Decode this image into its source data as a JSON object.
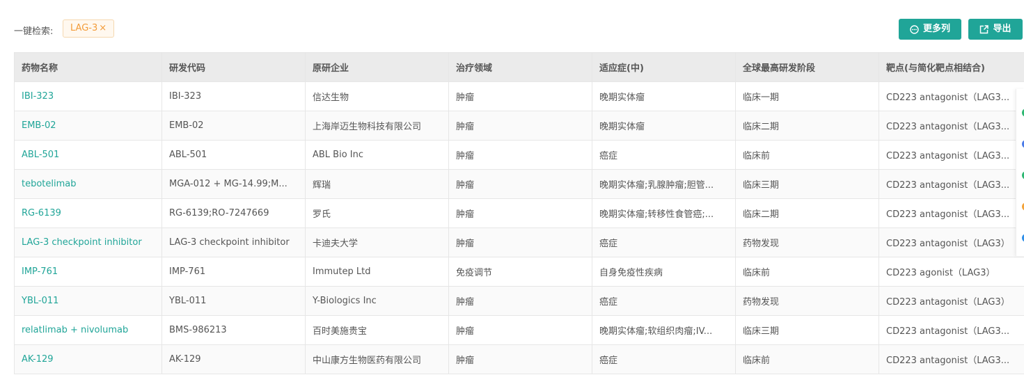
{
  "search": {
    "label": "一键检索:",
    "tag": "LAG-3",
    "tag_close": "×"
  },
  "toolbar": {
    "more_columns_label": "更多列",
    "export_label": "导出"
  },
  "table": {
    "headers": [
      "药物名称",
      "研发代码",
      "原研企业",
      "治疗领域",
      "适应症(中)",
      "全球最高研发阶段",
      "靶点(与简化靶点相结合)"
    ],
    "rows": [
      [
        "IBI-323",
        "IBI-323",
        "信达生物",
        "肿瘤",
        "晚期实体瘤",
        "临床一期",
        "CD223 antagonist（LAG3..."
      ],
      [
        "EMB-02",
        "EMB-02",
        "上海岸迈生物科技有限公司",
        "肿瘤",
        "晚期实体瘤",
        "临床二期",
        "CD223 antagonist（LAG3..."
      ],
      [
        "ABL-501",
        "ABL-501",
        "ABL Bio Inc",
        "肿瘤",
        "癌症",
        "临床前",
        "CD223 antagonist（LAG3..."
      ],
      [
        "tebotelimab",
        "MGA-012 + MG-14.99;M...",
        "辉瑞",
        "肿瘤",
        "晚期实体瘤;乳腺肿瘤;胆管...",
        "临床三期",
        "CD223 antagonist（LAG3..."
      ],
      [
        "RG-6139",
        "RG-6139;RO-7247669",
        "罗氏",
        "肿瘤",
        "晚期实体瘤;转移性食管癌;...",
        "临床二期",
        "CD223 antagonist（LAG3..."
      ],
      [
        "LAG-3 checkpoint inhibitor",
        "LAG-3 checkpoint inhibitor",
        "卡迪夫大学",
        "肿瘤",
        "癌症",
        "药物发现",
        "CD223 antagonist（LAG3）"
      ],
      [
        "IMP-761",
        "IMP-761",
        "Immutep Ltd",
        "免疫调节",
        "自身免疫性疾病",
        "临床前",
        "CD223 agonist（LAG3）"
      ],
      [
        "YBL-011",
        "YBL-011",
        "Y-Biologics Inc",
        "肿瘤",
        "癌症",
        "药物发现",
        "CD223 antagonist（LAG3）"
      ],
      [
        "relatlimab + nivolumab",
        "BMS-986213",
        "百时美施贵宝",
        "肿瘤",
        "晚期实体瘤;软组织肉瘤;IV...",
        "临床三期",
        "CD223 antagonist（LAG3..."
      ],
      [
        "AK-129",
        "AK-129",
        "中山康方生物医药有限公司",
        "肿瘤",
        "癌症",
        "临床前",
        "CD223 antagonist（LAG3..."
      ]
    ]
  },
  "colors": {
    "accent": "#20a598",
    "tag_text": "#f39c39",
    "header_bg": "#ebebeb"
  },
  "side_dots": [
    "#2eb872",
    "#4a7be8",
    "#2eb872",
    "#f3a33a",
    "#2f8fe8"
  ]
}
